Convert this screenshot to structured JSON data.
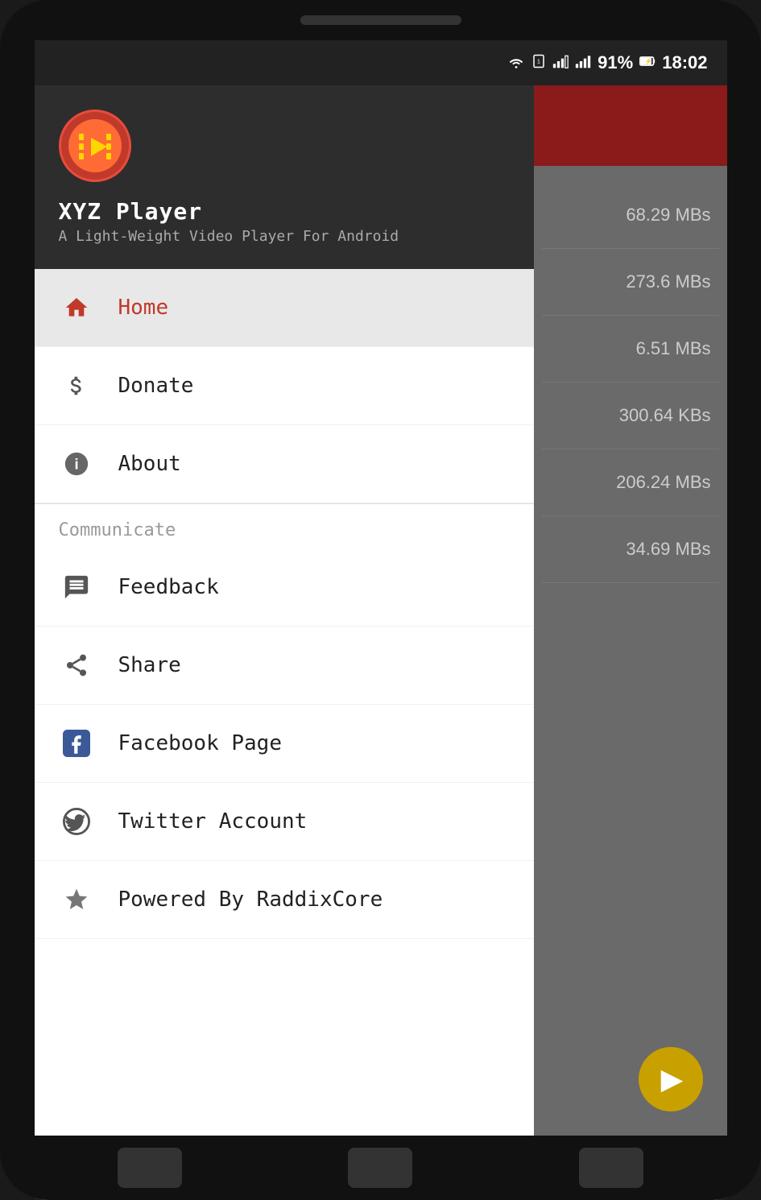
{
  "statusBar": {
    "battery": "91%",
    "time": "18:02",
    "icons": [
      "wifi",
      "sim1",
      "signal1",
      "signal2",
      "battery"
    ]
  },
  "app": {
    "name": "XYZ Player",
    "subtitle": "A Light-Weight Video Player For Android",
    "logoAlt": "XYZ Player Logo"
  },
  "drawer": {
    "activeItem": "Home",
    "sections": [
      {
        "items": [
          {
            "id": "home",
            "label": "Home",
            "icon": "home"
          },
          {
            "id": "donate",
            "label": "Donate",
            "icon": "dollar"
          },
          {
            "id": "about",
            "label": "About",
            "icon": "info"
          }
        ]
      },
      {
        "header": "Communicate",
        "items": [
          {
            "id": "feedback",
            "label": "Feedback",
            "icon": "feedback"
          },
          {
            "id": "share",
            "label": "Share",
            "icon": "share"
          },
          {
            "id": "facebook",
            "label": "Facebook Page",
            "icon": "facebook"
          },
          {
            "id": "twitter",
            "label": "Twitter Account",
            "icon": "twitter"
          },
          {
            "id": "powered",
            "label": "Powered By RaddixCore",
            "icon": "star"
          }
        ]
      }
    ]
  },
  "rightPanel": {
    "fileSizes": [
      "68.29 MBs",
      "273.6 MBs",
      "6.51 MBs",
      "300.64 KBs",
      "206.24 MBs",
      "34.69 MBs"
    ]
  },
  "fab": {
    "label": "▶"
  },
  "communicate": {
    "header": "Communicate"
  }
}
